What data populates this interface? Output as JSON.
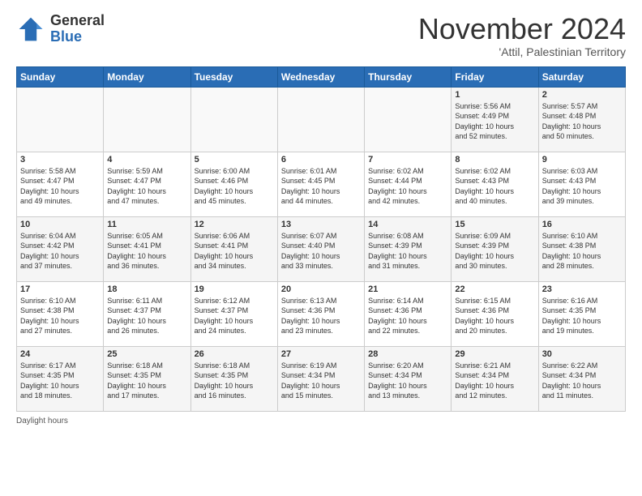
{
  "logo": {
    "general": "General",
    "blue": "Blue"
  },
  "header": {
    "month": "November 2024",
    "location": "'Attil, Palestinian Territory"
  },
  "days_of_week": [
    "Sunday",
    "Monday",
    "Tuesday",
    "Wednesday",
    "Thursday",
    "Friday",
    "Saturday"
  ],
  "weeks": [
    [
      {
        "day": "",
        "info": ""
      },
      {
        "day": "",
        "info": ""
      },
      {
        "day": "",
        "info": ""
      },
      {
        "day": "",
        "info": ""
      },
      {
        "day": "",
        "info": ""
      },
      {
        "day": "1",
        "info": "Sunrise: 5:56 AM\nSunset: 4:49 PM\nDaylight: 10 hours\nand 52 minutes."
      },
      {
        "day": "2",
        "info": "Sunrise: 5:57 AM\nSunset: 4:48 PM\nDaylight: 10 hours\nand 50 minutes."
      }
    ],
    [
      {
        "day": "3",
        "info": "Sunrise: 5:58 AM\nSunset: 4:47 PM\nDaylight: 10 hours\nand 49 minutes."
      },
      {
        "day": "4",
        "info": "Sunrise: 5:59 AM\nSunset: 4:47 PM\nDaylight: 10 hours\nand 47 minutes."
      },
      {
        "day": "5",
        "info": "Sunrise: 6:00 AM\nSunset: 4:46 PM\nDaylight: 10 hours\nand 45 minutes."
      },
      {
        "day": "6",
        "info": "Sunrise: 6:01 AM\nSunset: 4:45 PM\nDaylight: 10 hours\nand 44 minutes."
      },
      {
        "day": "7",
        "info": "Sunrise: 6:02 AM\nSunset: 4:44 PM\nDaylight: 10 hours\nand 42 minutes."
      },
      {
        "day": "8",
        "info": "Sunrise: 6:02 AM\nSunset: 4:43 PM\nDaylight: 10 hours\nand 40 minutes."
      },
      {
        "day": "9",
        "info": "Sunrise: 6:03 AM\nSunset: 4:43 PM\nDaylight: 10 hours\nand 39 minutes."
      }
    ],
    [
      {
        "day": "10",
        "info": "Sunrise: 6:04 AM\nSunset: 4:42 PM\nDaylight: 10 hours\nand 37 minutes."
      },
      {
        "day": "11",
        "info": "Sunrise: 6:05 AM\nSunset: 4:41 PM\nDaylight: 10 hours\nand 36 minutes."
      },
      {
        "day": "12",
        "info": "Sunrise: 6:06 AM\nSunset: 4:41 PM\nDaylight: 10 hours\nand 34 minutes."
      },
      {
        "day": "13",
        "info": "Sunrise: 6:07 AM\nSunset: 4:40 PM\nDaylight: 10 hours\nand 33 minutes."
      },
      {
        "day": "14",
        "info": "Sunrise: 6:08 AM\nSunset: 4:39 PM\nDaylight: 10 hours\nand 31 minutes."
      },
      {
        "day": "15",
        "info": "Sunrise: 6:09 AM\nSunset: 4:39 PM\nDaylight: 10 hours\nand 30 minutes."
      },
      {
        "day": "16",
        "info": "Sunrise: 6:10 AM\nSunset: 4:38 PM\nDaylight: 10 hours\nand 28 minutes."
      }
    ],
    [
      {
        "day": "17",
        "info": "Sunrise: 6:10 AM\nSunset: 4:38 PM\nDaylight: 10 hours\nand 27 minutes."
      },
      {
        "day": "18",
        "info": "Sunrise: 6:11 AM\nSunset: 4:37 PM\nDaylight: 10 hours\nand 26 minutes."
      },
      {
        "day": "19",
        "info": "Sunrise: 6:12 AM\nSunset: 4:37 PM\nDaylight: 10 hours\nand 24 minutes."
      },
      {
        "day": "20",
        "info": "Sunrise: 6:13 AM\nSunset: 4:36 PM\nDaylight: 10 hours\nand 23 minutes."
      },
      {
        "day": "21",
        "info": "Sunrise: 6:14 AM\nSunset: 4:36 PM\nDaylight: 10 hours\nand 22 minutes."
      },
      {
        "day": "22",
        "info": "Sunrise: 6:15 AM\nSunset: 4:36 PM\nDaylight: 10 hours\nand 20 minutes."
      },
      {
        "day": "23",
        "info": "Sunrise: 6:16 AM\nSunset: 4:35 PM\nDaylight: 10 hours\nand 19 minutes."
      }
    ],
    [
      {
        "day": "24",
        "info": "Sunrise: 6:17 AM\nSunset: 4:35 PM\nDaylight: 10 hours\nand 18 minutes."
      },
      {
        "day": "25",
        "info": "Sunrise: 6:18 AM\nSunset: 4:35 PM\nDaylight: 10 hours\nand 17 minutes."
      },
      {
        "day": "26",
        "info": "Sunrise: 6:18 AM\nSunset: 4:35 PM\nDaylight: 10 hours\nand 16 minutes."
      },
      {
        "day": "27",
        "info": "Sunrise: 6:19 AM\nSunset: 4:34 PM\nDaylight: 10 hours\nand 15 minutes."
      },
      {
        "day": "28",
        "info": "Sunrise: 6:20 AM\nSunset: 4:34 PM\nDaylight: 10 hours\nand 13 minutes."
      },
      {
        "day": "29",
        "info": "Sunrise: 6:21 AM\nSunset: 4:34 PM\nDaylight: 10 hours\nand 12 minutes."
      },
      {
        "day": "30",
        "info": "Sunrise: 6:22 AM\nSunset: 4:34 PM\nDaylight: 10 hours\nand 11 minutes."
      }
    ]
  ],
  "footer": {
    "daylight_label": "Daylight hours"
  }
}
